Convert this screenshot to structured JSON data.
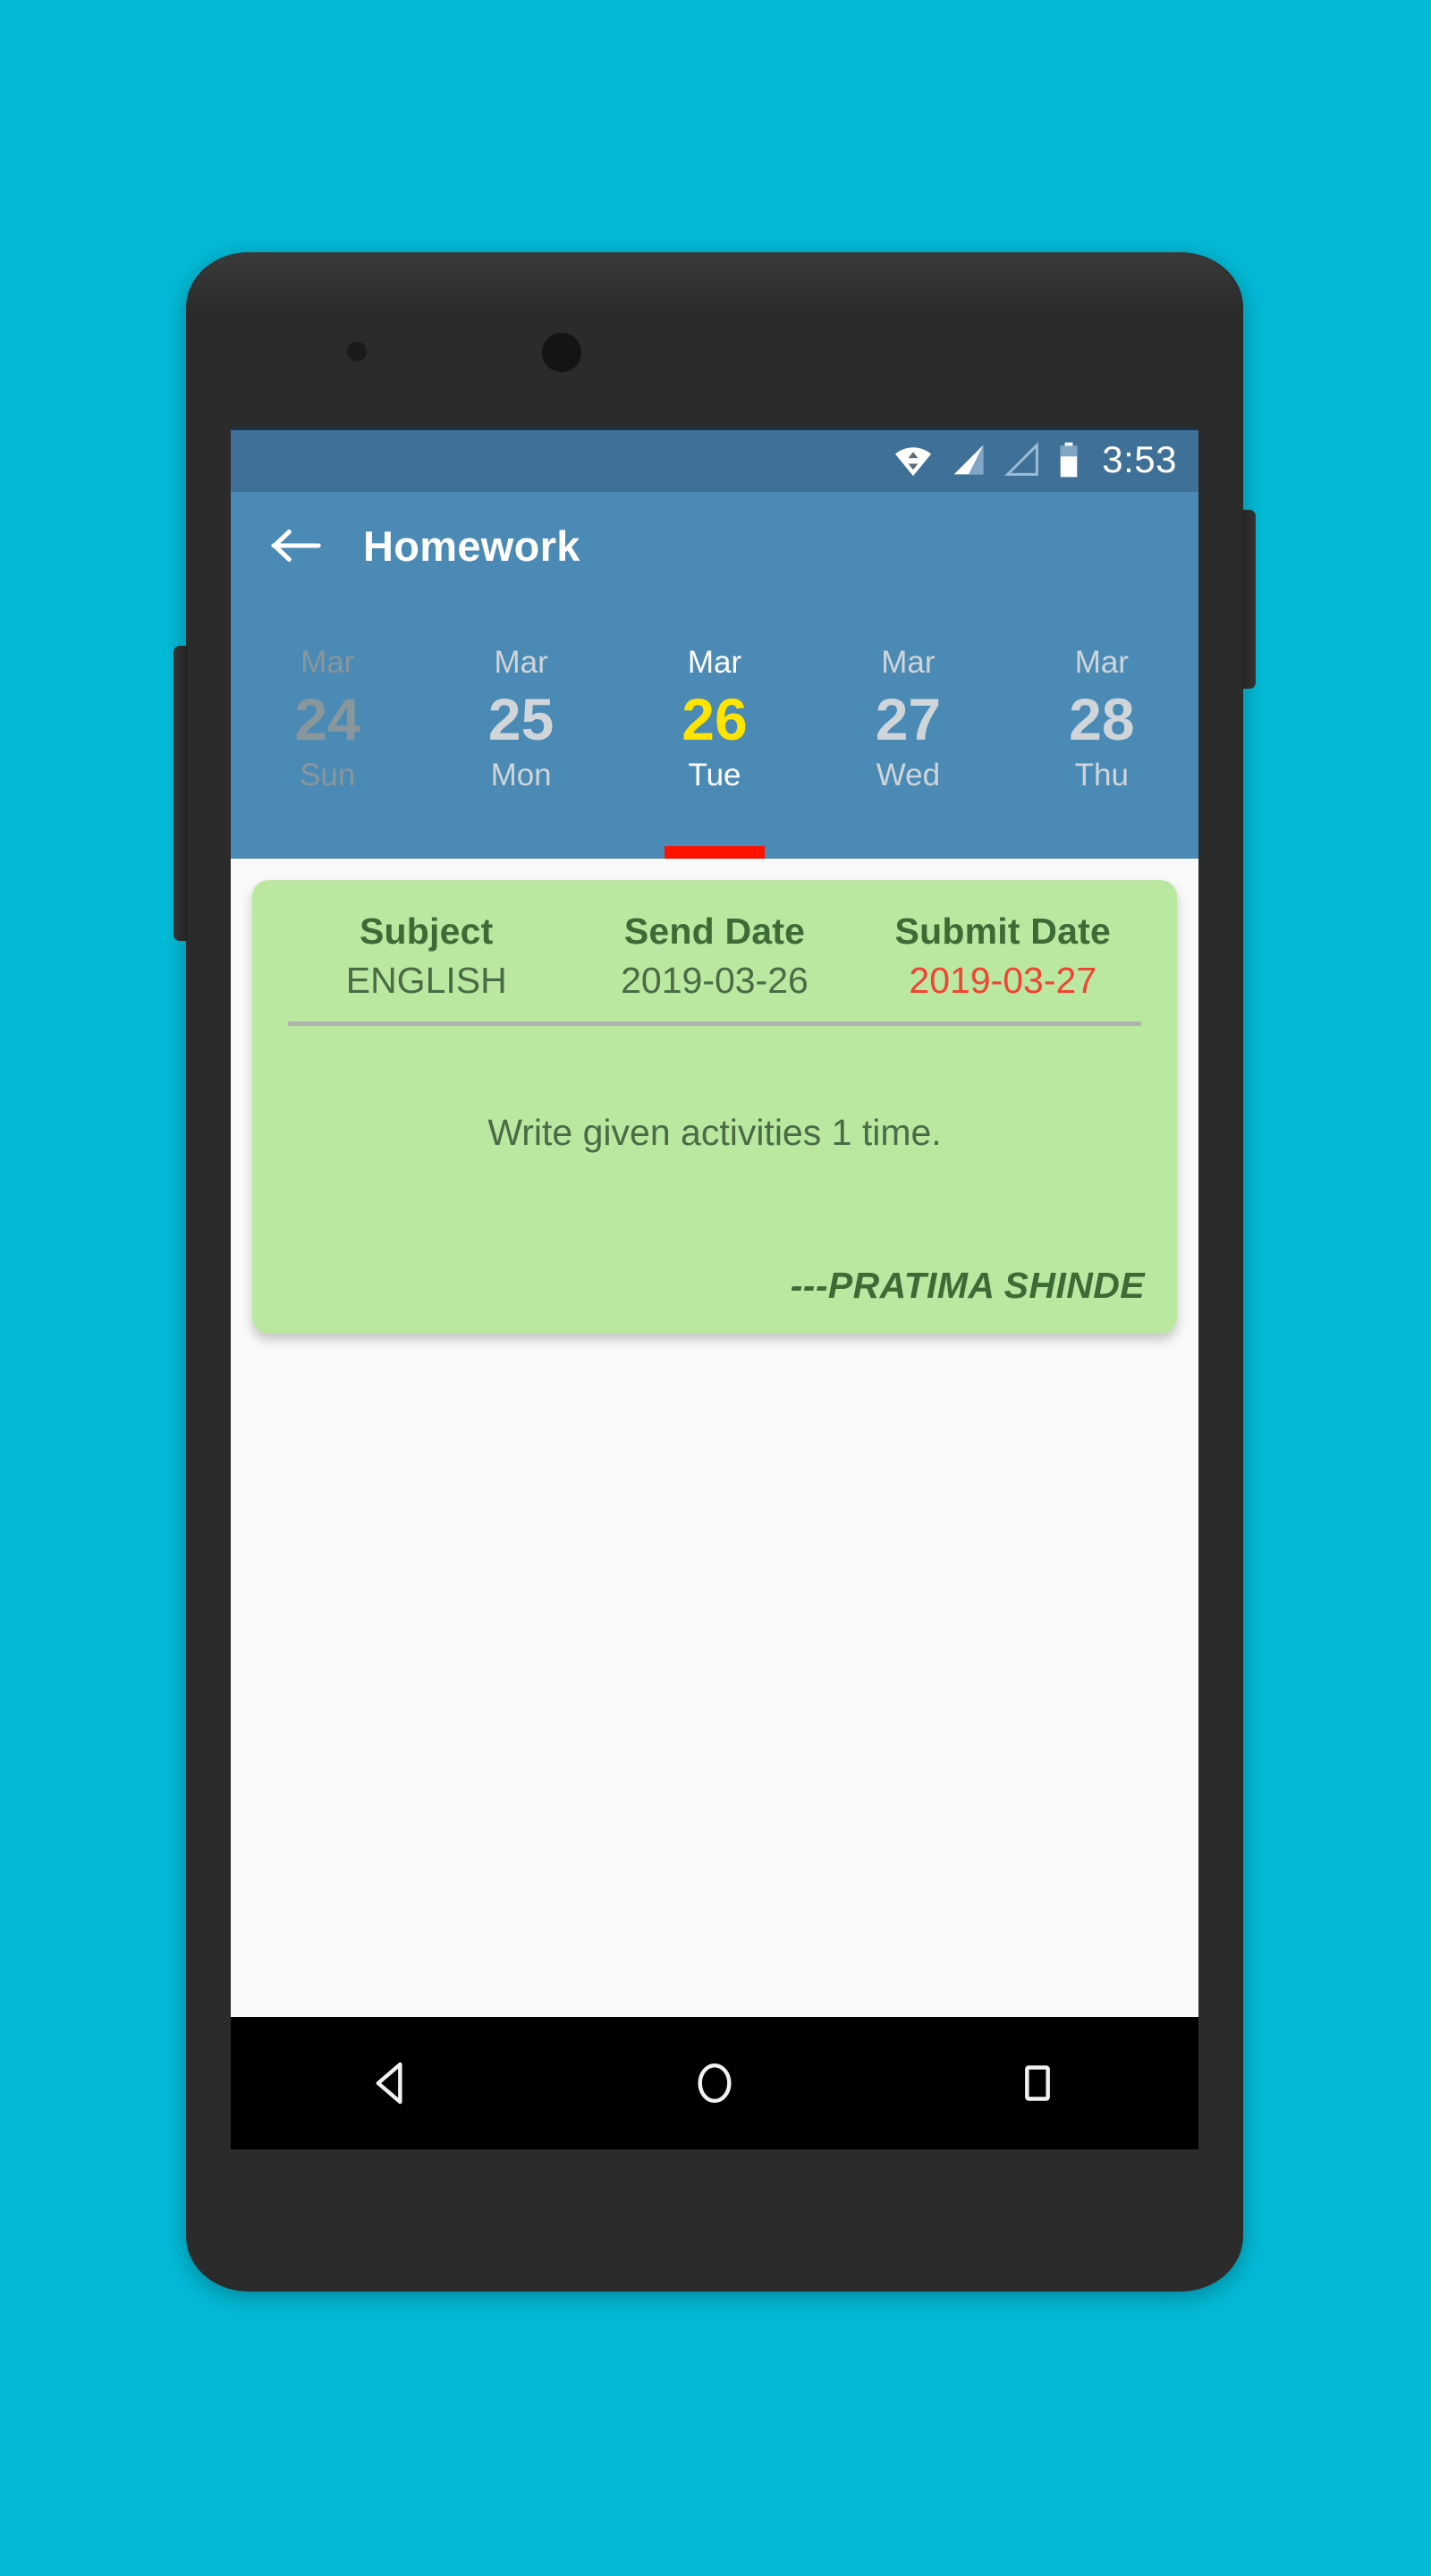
{
  "background_color": "#03bad6",
  "device": {
    "frame_color": "#2b2b2b",
    "sensor_icon": "proximity-sensor",
    "camera_icon": "front-camera",
    "volume_icon": "volume-rocker",
    "power_icon": "power-button"
  },
  "status_bar": {
    "background": "#3e7098",
    "wifi_icon": "wifi-transfer-icon",
    "signal_icon_1": "cell-signal-full-icon",
    "signal_icon_2": "cell-signal-empty-icon",
    "battery_icon": "battery-icon",
    "clock": "3:53"
  },
  "app_bar": {
    "background": "#4a8ab5",
    "back_icon": "back-arrow-icon",
    "title": "Homework"
  },
  "date_tabs": {
    "indicator_color": "#ff1200",
    "selected_index": 2,
    "items": [
      {
        "month": "Mar",
        "day": "24",
        "weekday": "Sun",
        "state": "faded"
      },
      {
        "month": "Mar",
        "day": "25",
        "weekday": "Mon",
        "state": "normal"
      },
      {
        "month": "Mar",
        "day": "26",
        "weekday": "Tue",
        "state": "selected"
      },
      {
        "month": "Mar",
        "day": "27",
        "weekday": "Wed",
        "state": "normal"
      },
      {
        "month": "Mar",
        "day": "28",
        "weekday": "Thu",
        "state": "normal"
      }
    ]
  },
  "homework_card": {
    "background": "#bbe8a0",
    "columns": [
      {
        "label": "Subject",
        "value": "ENGLISH"
      },
      {
        "label": "Send Date",
        "value": "2019-03-26"
      },
      {
        "label": "Submit Date",
        "value": "2019-03-27",
        "value_color": "#f04434"
      }
    ],
    "description": "Write given activities 1 time.",
    "signature": "---PRATIMA SHINDE"
  },
  "nav_bar": {
    "background": "#000000",
    "back_icon": "nav-back-triangle-icon",
    "home_icon": "nav-home-circle-icon",
    "recents_icon": "nav-recents-square-icon"
  }
}
